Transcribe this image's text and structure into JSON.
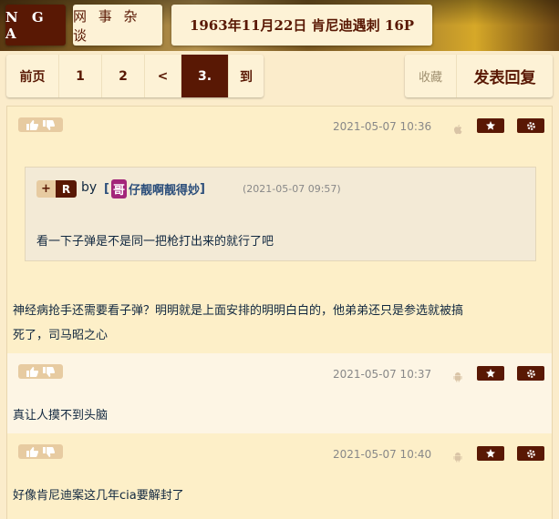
{
  "header": {
    "logo": "N G A",
    "board": "网 事 杂 谈",
    "topic": "1963年11月22日 肯尼迪遇刺 16P"
  },
  "pager": {
    "items": [
      "前页",
      "1",
      "2",
      "<",
      "3.",
      "到"
    ],
    "active": "3."
  },
  "actions": {
    "favorite": "收藏",
    "reply": "发表回复"
  },
  "posts": [
    {
      "time": "2021-05-07 10:36",
      "device": "apple-icon",
      "quote": {
        "plus": "+",
        "r": "R",
        "by": "by",
        "name_prefix": "[",
        "badge": "哥",
        "name": "仔靓啊靓得妙",
        "name_suffix": "]",
        "time": "(2021-05-07 09:57)",
        "text": "看一下子弹是不是同一把枪打出来的就行了吧"
      },
      "text_line1": "神经病抢手还需要看子弹？明明就是上面安排的明明白白的，他弟弟还只是参选就被搞",
      "text_line2": "死了，司马昭之心"
    },
    {
      "time": "2021-05-07 10:37",
      "device": "android-icon",
      "text": "真让人摸不到头脑"
    },
    {
      "time": "2021-05-07 10:40",
      "device": "android-icon",
      "text": "好像肯尼迪案这几年cia要解封了"
    }
  ],
  "colors": {
    "brand": "#591804",
    "background": "#fbeccb",
    "post_alt": "#fdf5e4",
    "text": "#10273f"
  }
}
